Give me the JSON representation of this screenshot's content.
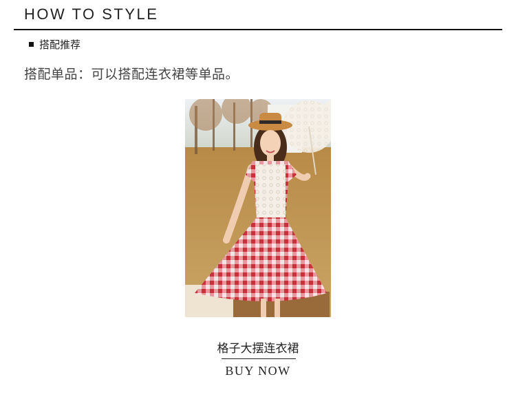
{
  "header": {
    "title": "HOW TO STYLE"
  },
  "section": {
    "label": "搭配推荐"
  },
  "pairing": {
    "text": "搭配单品：可以搭配连衣裙等单品。"
  },
  "product": {
    "image_icon": "product-photo",
    "name": "格子大摆连衣裙",
    "cta_label": "BUY NOW"
  },
  "colors": {
    "rule": "#111111",
    "text": "#222222",
    "dress": "#d9434f"
  }
}
